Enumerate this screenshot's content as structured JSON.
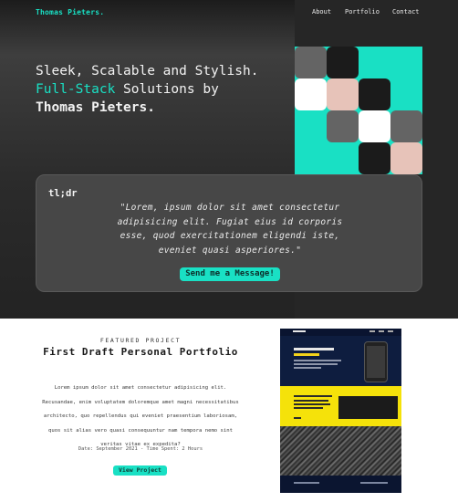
{
  "header": {
    "brand": "Thomas Pieters.",
    "nav": [
      "About",
      "Portfolio",
      "Contact"
    ]
  },
  "hero": {
    "line1": "Sleek, Scalable and Stylish.",
    "line2_accent": "Full-Stack",
    "line2_rest": " Solutions by",
    "line3": "Thomas Pieters.",
    "accent_color": "#19e0c4"
  },
  "mosaic_colors": [
    "#19e0c4",
    "#646464",
    "#1b1b1b",
    "#ffffff",
    "#e7c3b9"
  ],
  "card": {
    "tag": "tl;dr",
    "quote": "\"Lorem, ipsum dolor sit amet consectetur adipisicing elit. Fugiat eius id corporis esse, quod exercitationem eligendi iste, eveniet quasi asperiores.\"",
    "cta": "Send me a Message!"
  },
  "featured": {
    "eyebrow": "FEATURED PROJECT",
    "title": "First Draft Personal Portfolio",
    "description": "Lorem ipsum dolor sit amet consectetur adipisicing elit. Recusandae, enim voluptatem doloremque amet magni necessitatibus architecto, quo repellendus qui eveniet praesentium laboriosam, quos sit alias vero quasi consequuntur nam tempora nemo sint veritas vitae ex expedita?",
    "meta": "Date: September 2021 - Time Spent: 2 Hours",
    "cta": "View Project"
  }
}
